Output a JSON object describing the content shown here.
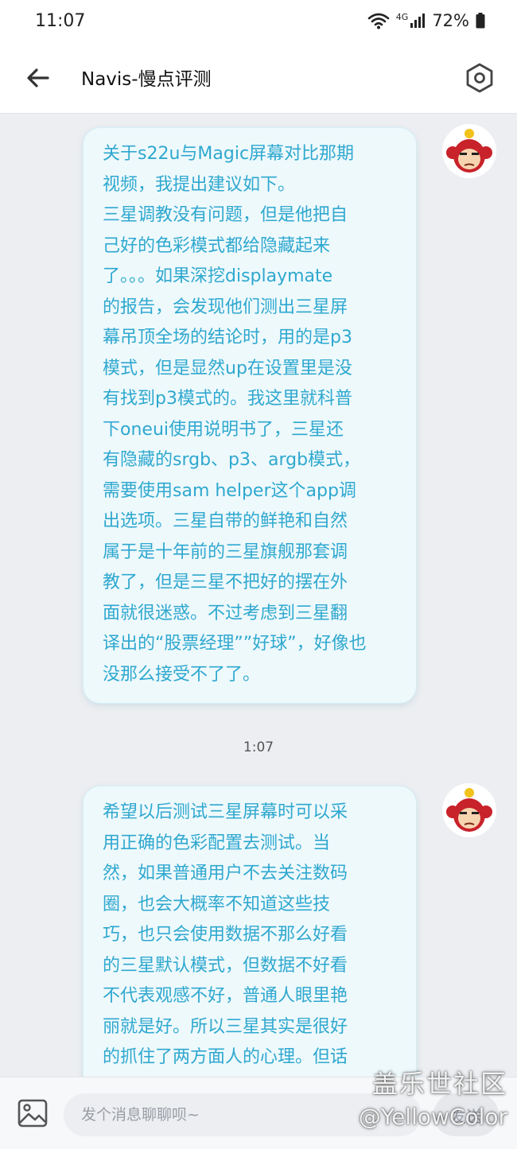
{
  "status_bar": {
    "time": "11:07",
    "network": "4G",
    "battery": "72%"
  },
  "header": {
    "title": "Navis-慢点评测"
  },
  "messages": [
    {
      "lines": [
        "关于s22u与Magic屏幕对比那期",
        "视频，我提出建议如下。",
        "三星调教没有问题，但是他把自",
        "己好的色彩模式都给隐藏起来",
        "了。。。如果深挖displaymate",
        "的报告，会发现他们测出三星屏",
        "幕吊顶全场的结论时，用的是p3",
        "模式，但是显然up在设置里是没",
        "有找到p3模式的。我这里就科普",
        "下oneui使用说明书了，三星还",
        "有隐藏的srgb、p3、argb模式，",
        "需要使用sam helper这个app调",
        "出选项。三星自带的鲜艳和自然",
        "属于是十年前的三星旗舰那套调",
        "教了，但是三星不把好的摆在外",
        "面就很迷惑。不过考虑到三星翻",
        "译出的“股票经理””好球”，好像也",
        "没那么接受不了了。"
      ]
    },
    {
      "lines": [
        "希望以后测试三星屏幕时可以采",
        "用正确的色彩配置去测试。当",
        "然，如果普通用户不去关注数码",
        "圈，也会大概率不知道这些技",
        "巧，也只会使用数据不那么好看",
        "的三星默认模式，但数据不好看",
        "不代表观感不好，普通人眼里艳",
        "丽就是好。所以三星其实是很好",
        "的抓住了两方面人的心理。但话"
      ]
    }
  ],
  "timestamp": "1:07",
  "composer": {
    "placeholder": "发个消息聊聊呗~",
    "send_label": "发送"
  },
  "watermark": {
    "line1": "盖乐世社区",
    "line2": "@YellowColor"
  },
  "colors": {
    "bubble_text": "#2fa8cf",
    "bubble_bg": "#eef9fc",
    "page_bg": "#eceef1"
  }
}
